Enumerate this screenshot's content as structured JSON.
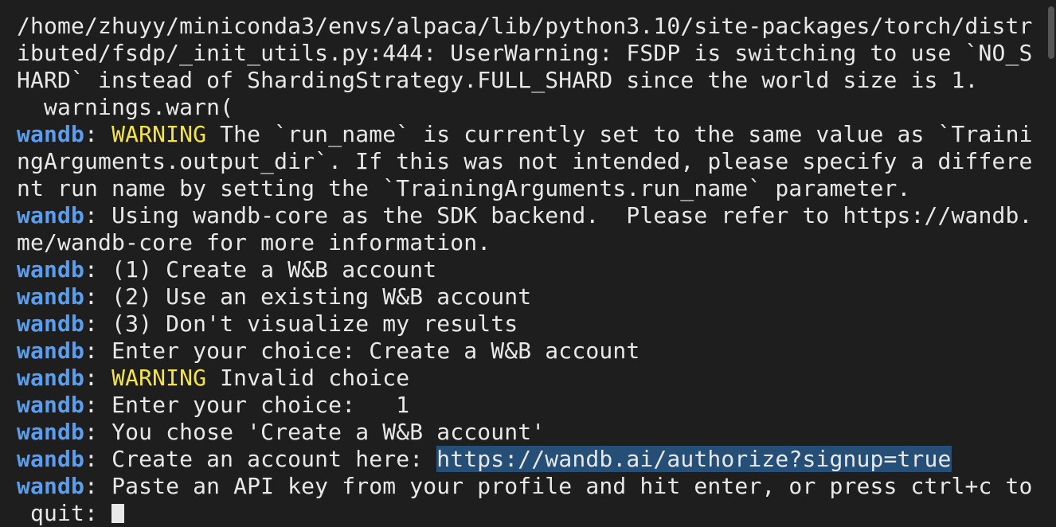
{
  "terminal": {
    "prefix": "wandb",
    "lines": [
      {
        "text": "     "
      },
      {
        "text": "/home/zhuyy/miniconda3/envs/alpaca/lib/python3.10/site-packages/torch/distr"
      },
      {
        "text": "ibuted/fsdp/_init_utils.py:444: UserWarning: FSDP is switching to use `NO_S"
      },
      {
        "text": "HARD` instead of ShardingStrategy.FULL_SHARD since the world size is 1."
      },
      {
        "text": "  warnings.warn("
      },
      {
        "prefix": "wandb",
        "sep": ": ",
        "tag": "WARNING",
        "text": " The `run_name` is currently set to the same value as `Traini"
      },
      {
        "text": "ngArguments.output_dir`. If this was not intended, please specify a differe"
      },
      {
        "text": "nt run name by setting the `TrainingArguments.run_name` parameter."
      },
      {
        "prefix": "wandb",
        "sep": ": ",
        "text": "Using wandb-core as the SDK backend.  Please refer to https://wandb."
      },
      {
        "text": "me/wandb-core for more information."
      },
      {
        "prefix": "wandb",
        "sep": ": ",
        "text": "(1) Create a W&B account"
      },
      {
        "prefix": "wandb",
        "sep": ": ",
        "text": "(2) Use an existing W&B account"
      },
      {
        "prefix": "wandb",
        "sep": ": ",
        "text": "(3) Don't visualize my results"
      },
      {
        "prefix": "wandb",
        "sep": ": ",
        "text": "Enter your choice: Create a W&B account"
      },
      {
        "prefix": "wandb",
        "sep": ": ",
        "tag": "WARNING",
        "text": " Invalid choice"
      },
      {
        "prefix": "wandb",
        "sep": ": ",
        "text": "Enter your choice:   1"
      },
      {
        "prefix": "wandb",
        "sep": ": ",
        "text": "You chose 'Create a W&B account'"
      },
      {
        "prefix": "wandb",
        "sep": ": ",
        "text": "Create an account here: ",
        "link": "https://wandb.ai/authorize?signup=true"
      },
      {
        "prefix": "wandb",
        "sep": ": ",
        "text": "Paste an API key from your profile and hit enter, or press ctrl+c to"
      },
      {
        "text": " quit: ",
        "cursor": true
      }
    ]
  },
  "colors": {
    "background": "#1e1e1e",
    "foreground": "#e8e8e8",
    "prefix": "#5b9ef0",
    "warning": "#f4e34a",
    "selection": "#264f78"
  }
}
